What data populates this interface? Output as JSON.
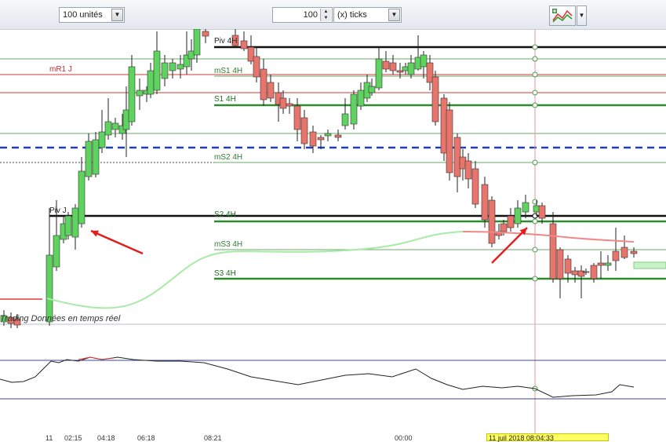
{
  "toolbar": {
    "units_value": "100 unités",
    "ticks_value": "100",
    "ticks_mode": "(x) ticks",
    "tool_icon": "chart-tools-icon",
    "dropdown_icon": "chevron-down-icon"
  },
  "levels": {
    "piv_4h": "Piv 4H",
    "mr1_j": "mR1 J",
    "ms1_4h": "mS1 4H",
    "s1_4h": "S1 4H",
    "ms2_4h": "mS2 4H",
    "piv_j": "Piv J",
    "s2_4h": "S2 4H",
    "ms3_4h": "mS3 4H",
    "s3_4h": "S3 4H"
  },
  "source_label": "Trading  Données en temps réel",
  "times": [
    "11",
    "02:15",
    "04:18",
    "06:18",
    "08:21",
    "00:00"
  ],
  "date_tag": "11 juil 2018 08:04:33",
  "colors": {
    "bull": "#5fd35f",
    "bear": "#e8756b",
    "pivot": "#111111",
    "support": "#2e8b2e",
    "resistance": "#d23a3a",
    "dashed_blue": "#1f3fbf",
    "cursor": "#e59a9a",
    "arrow": "#e02020"
  }
}
